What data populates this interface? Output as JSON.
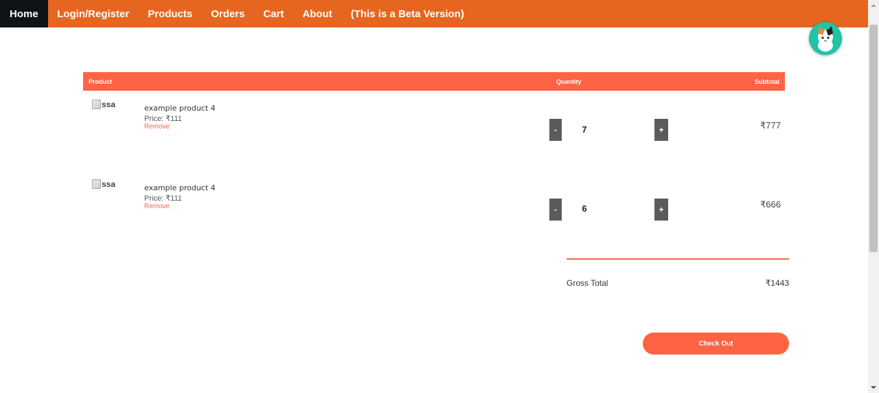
{
  "nav": {
    "items": [
      {
        "label": "Home",
        "active": true
      },
      {
        "label": "Login/Register"
      },
      {
        "label": "Products"
      },
      {
        "label": "Orders"
      },
      {
        "label": "Cart"
      },
      {
        "label": "About"
      },
      {
        "label": "(This is a Beta Version)"
      }
    ],
    "color": "#e7661f",
    "active_color": "#0f1316"
  },
  "avatar": {
    "icon": "cat-avatar-icon",
    "bg_color": "#1fc3a8"
  },
  "table": {
    "headers": {
      "product": "Product",
      "quantity": "Quantity",
      "subtotal": "Subtotal"
    },
    "accent": "#fe6343",
    "rows": [
      {
        "image_alt": "ssa",
        "name": "example product 4",
        "price": "Price: ₹111",
        "remove": "Remove",
        "minus": "-",
        "quantity": "7",
        "plus": "+",
        "subtotal": "₹777"
      },
      {
        "image_alt": "ssa",
        "name": "example product 4",
        "price": "Price: ₹111",
        "remove": "Remove",
        "minus": "-",
        "quantity": "6",
        "plus": "+",
        "subtotal": "₹666"
      }
    ]
  },
  "totals": {
    "gross_label": "Gross Total",
    "gross_value": "₹1443"
  },
  "checkout": {
    "label": "Check Out"
  }
}
